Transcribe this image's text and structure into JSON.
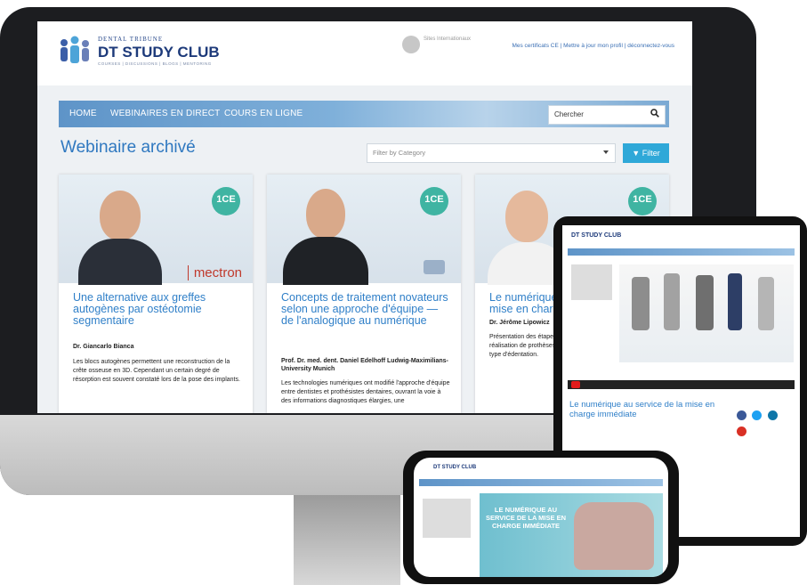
{
  "header": {
    "brand_small": "DENTAL TRIBUNE",
    "brand_title": "DT STUDY CLUB",
    "brand_tagline": "COURSES | DISCUSSIONS | BLOGS | MENTORING",
    "sites_label": "Sites Internationaux",
    "user_links": "Mes certificats CE | Mettre à jour mon profil | déconnectez-vous"
  },
  "nav": {
    "items": [
      "HOME",
      "WEBINAIRES EN DIRECT",
      "COURS EN LIGNE"
    ],
    "search_placeholder": "Chercher"
  },
  "main": {
    "title": "Webinaire archivé",
    "filter_placeholder": "Filter by Category",
    "filter_button": "Filter"
  },
  "cards": [
    {
      "badge": "1CE",
      "title": "Une alternative aux greffes autogènes par ostéotomie segmentaire",
      "author": "Dr. Giancarlo Bianca",
      "text": "Les blocs autogènes permettent une reconstruction de la crête osseuse en 3D. Cependant un certain degré de résorption est souvent constaté lors de la pose des implants.",
      "sponsor": "mectron"
    },
    {
      "badge": "1CE",
      "title": "Concepts de traitement novateurs selon une approche d'équipe — de l'analogique au numérique",
      "author": "Prof. Dr. med. dent. Daniel Edelhoff Ludwig-Maximilians-University Munich",
      "text": "Les technologies numériques ont modifié l'approche d'équipe entre dentistes et prothésistes dentaires, ouvrant la voie à des informations diagnostiques élargies, une"
    },
    {
      "badge": "1CE",
      "title": "Le numérique au service de la mise en charge immédiate",
      "author": "Dr. Jérôme Lipowicz",
      "text": "Présentation des étapes depuis la planification jusqu'à la réalisation de prothèses avec des protocoles rapides selon le type d'édentation."
    }
  ],
  "tablet": {
    "video_title": "Le numérique au service de la mise en charge immédiate"
  },
  "phone": {
    "banner": "LE NUMÉRIQUE AU SERVICE DE LA MISE EN CHARGE IMMÉDIATE"
  },
  "colors": {
    "accent": "#2f7fc8",
    "badge": "#3fb4a2",
    "filter": "#2fa8d8"
  }
}
